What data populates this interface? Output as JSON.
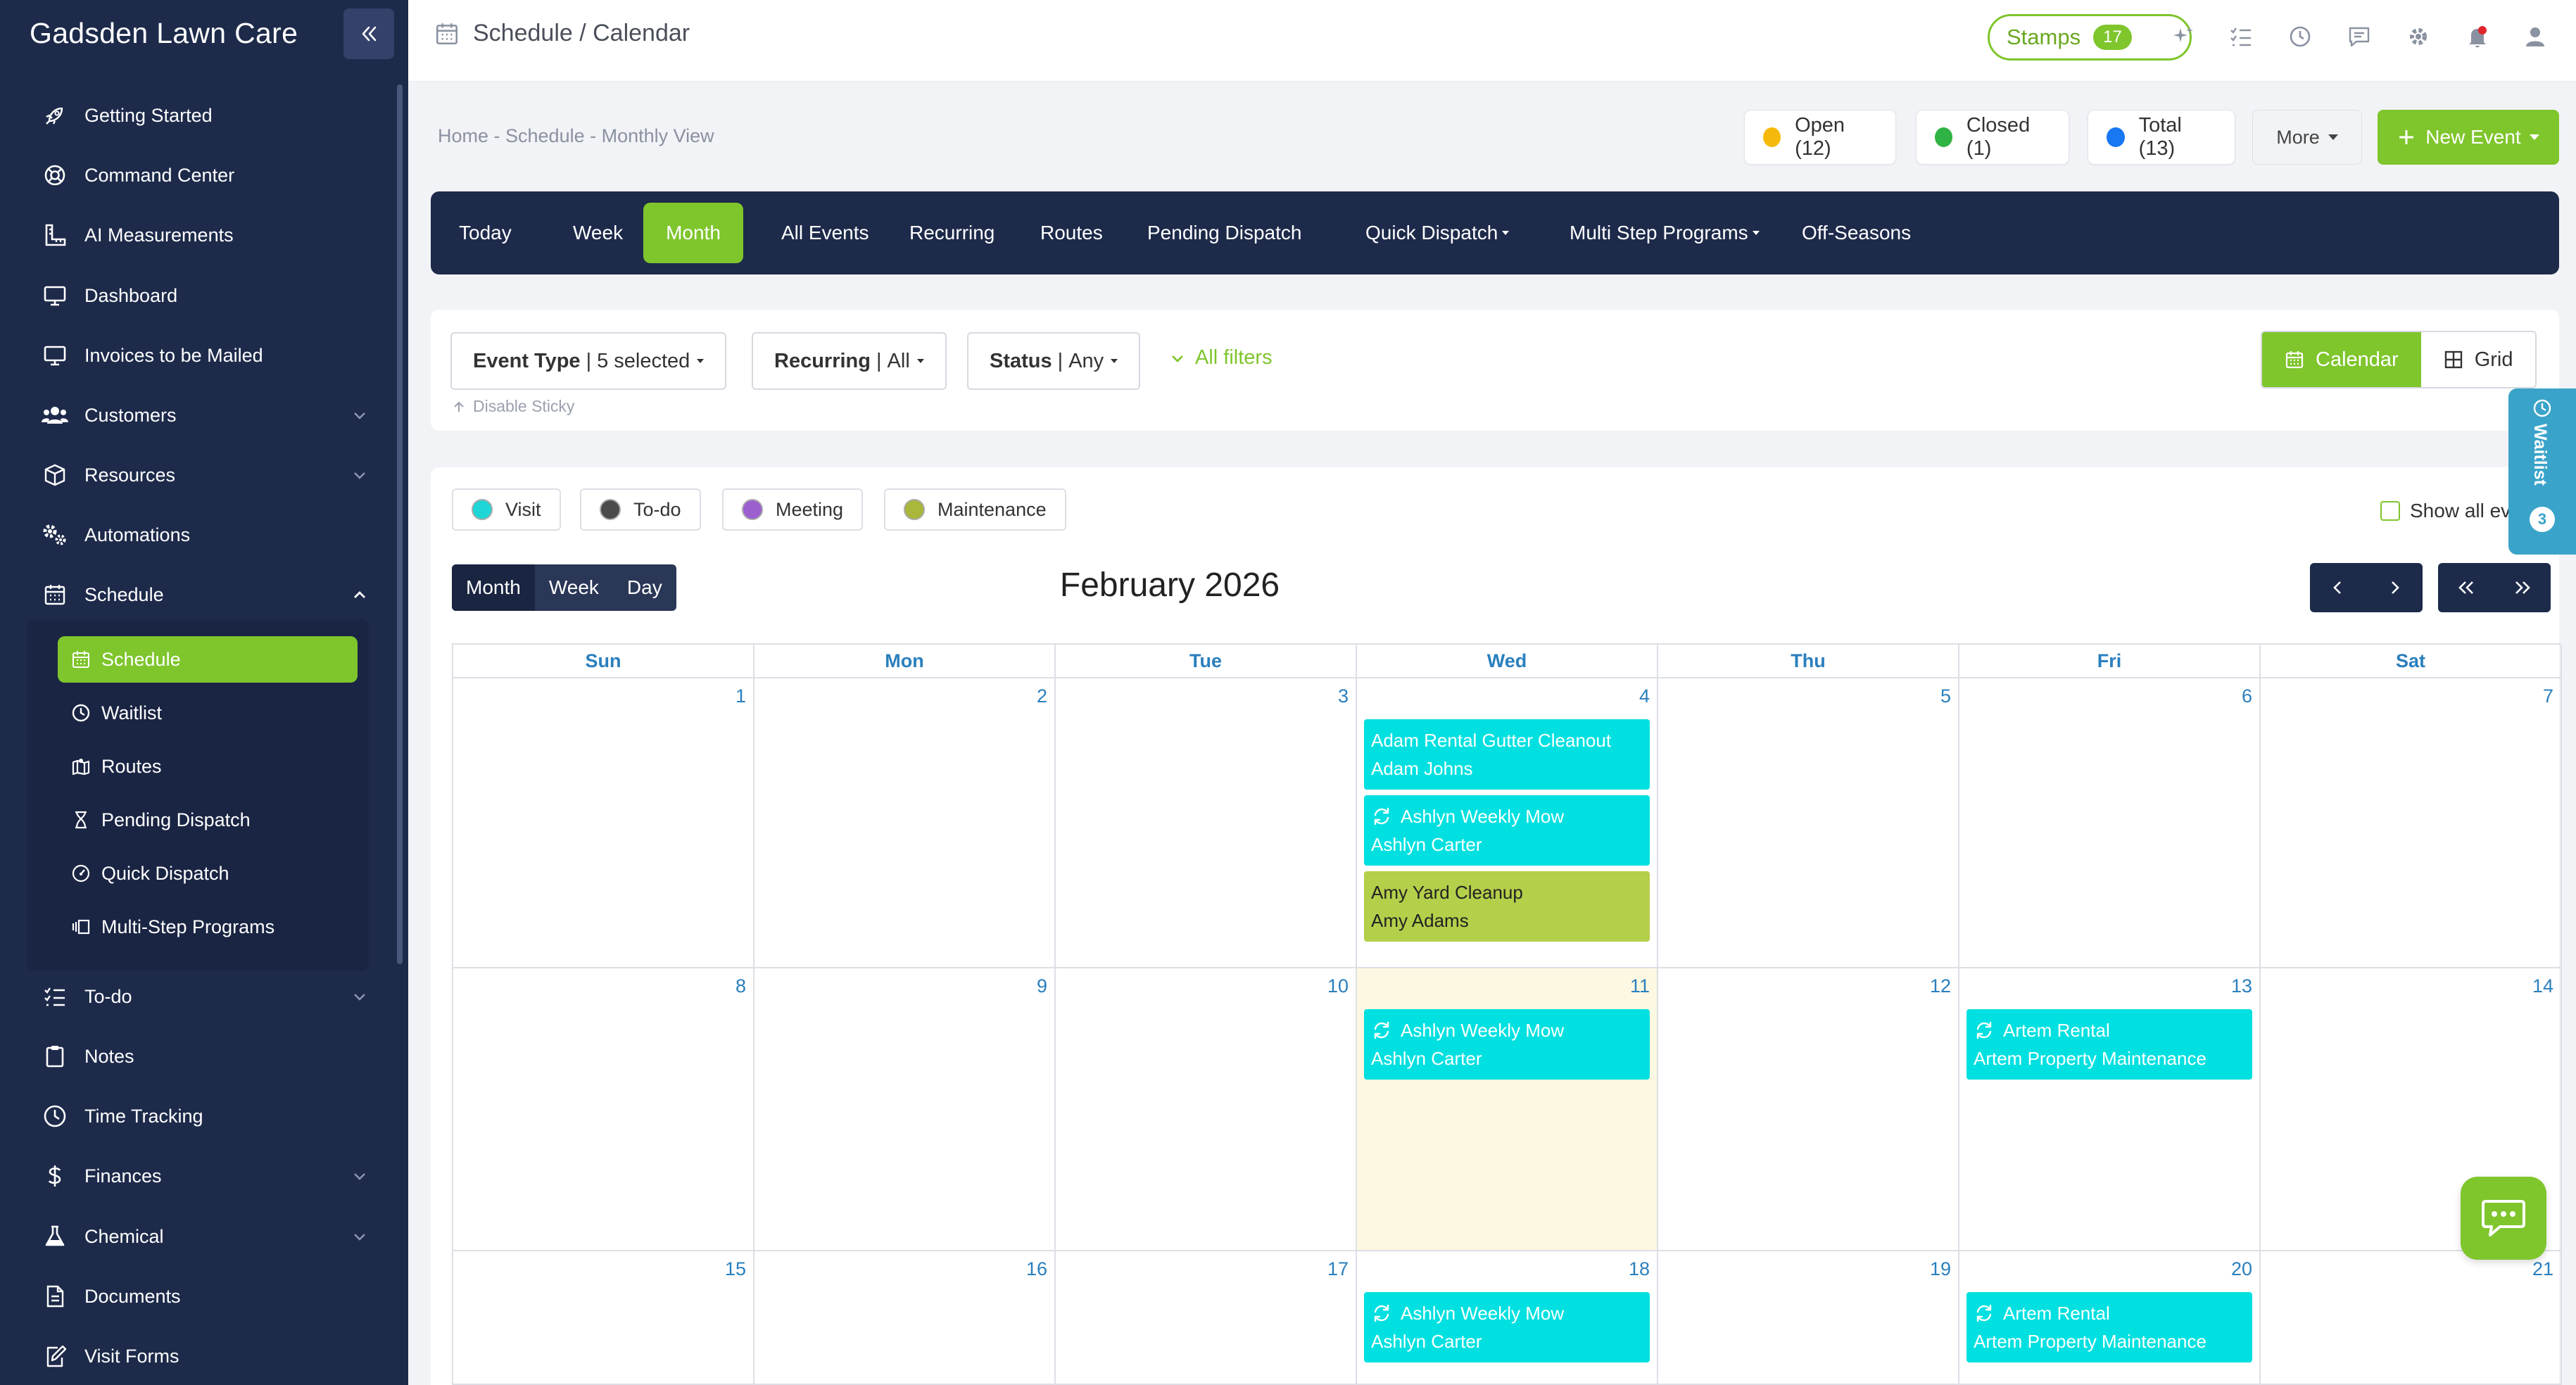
{
  "app": {
    "brand": "Gadsden Lawn Care"
  },
  "sidebar": {
    "items": [
      {
        "label": "Getting Started",
        "icon": "rocket-icon"
      },
      {
        "label": "Command Center",
        "icon": "life-ring-icon"
      },
      {
        "label": "AI Measurements",
        "icon": "ruler-icon"
      },
      {
        "label": "Dashboard",
        "icon": "monitor-icon"
      },
      {
        "label": "Invoices to be Mailed",
        "icon": "monitor-icon"
      },
      {
        "label": "Customers",
        "icon": "users-icon"
      },
      {
        "label": "Resources",
        "icon": "box-icon"
      },
      {
        "label": "Automations",
        "icon": "gears-icon"
      },
      {
        "label": "Schedule",
        "icon": "calendar-icon"
      }
    ],
    "schedule_sub": [
      {
        "label": "Schedule",
        "icon": "calendar-icon"
      },
      {
        "label": "Waitlist",
        "icon": "clock-icon"
      },
      {
        "label": "Routes",
        "icon": "map-icon"
      },
      {
        "label": "Pending Dispatch",
        "icon": "hourglass-icon"
      },
      {
        "label": "Quick Dispatch",
        "icon": "gauge-icon"
      },
      {
        "label": "Multi-Step Programs",
        "icon": "layers-icon"
      }
    ],
    "bottom_items": [
      {
        "label": "To-do",
        "icon": "list-check-icon"
      },
      {
        "label": "Notes",
        "icon": "clipboard-icon"
      },
      {
        "label": "Time Tracking",
        "icon": "clock-icon"
      },
      {
        "label": "Finances",
        "icon": "dollar-icon"
      },
      {
        "label": "Chemical",
        "icon": "flask-icon"
      },
      {
        "label": "Documents",
        "icon": "document-icon"
      },
      {
        "label": "Visit Forms",
        "icon": "edit-icon"
      }
    ]
  },
  "topbar": {
    "title": "Schedule / Calendar",
    "stamps_label": "Stamps",
    "stamps_count": "17"
  },
  "breadcrumb": "Home - Schedule - Monthly View",
  "status": {
    "open": "Open (12)",
    "closed": "Closed (1)",
    "total": "Total (13)",
    "colors": {
      "open": "#f5b90b",
      "closed": "#2fb344",
      "total": "#1877f2"
    }
  },
  "actions": {
    "more": "More",
    "new_event": "New Event"
  },
  "tabs": [
    "Today",
    "Week",
    "Month",
    "All Events",
    "Recurring",
    "Routes",
    "Pending Dispatch",
    "Quick Dispatch",
    "Multi Step Programs",
    "Off-Seasons"
  ],
  "filters": {
    "event_type_label": "Event Type",
    "event_type_value": "5 selected",
    "recurring_label": "Recurring",
    "recurring_value": "All",
    "status_label": "Status",
    "status_value": "Any",
    "all_filters": "All filters",
    "disable_sticky": "Disable Sticky",
    "view_calendar": "Calendar",
    "view_grid": "Grid"
  },
  "waitlist": {
    "label": "Waitlist",
    "count": "3"
  },
  "legend": [
    {
      "label": "Visit",
      "color": "#1fd6d6"
    },
    {
      "label": "To-do",
      "color": "#4a4a4a"
    },
    {
      "label": "Meeting",
      "color": "#9b5fd0"
    },
    {
      "label": "Maintenance",
      "color": "#a9b73a"
    }
  ],
  "calendar": {
    "show_all": "Show all ev",
    "view_modes": [
      "Month",
      "Week",
      "Day"
    ],
    "month_title": "February 2026",
    "weekdays": [
      "Sun",
      "Mon",
      "Tue",
      "Wed",
      "Thu",
      "Fri",
      "Sat"
    ],
    "weeks": [
      [
        "1",
        "2",
        "3",
        "4",
        "5",
        "6",
        "7"
      ],
      [
        "8",
        "9",
        "10",
        "11",
        "12",
        "13",
        "14"
      ],
      [
        "15",
        "16",
        "17",
        "18",
        "19",
        "20",
        "21"
      ]
    ],
    "events": {
      "4": [
        {
          "title": "Adam Rental Gutter Cleanout",
          "subtitle": "Adam Johns",
          "type": "visit",
          "recurring": false
        },
        {
          "title": "Ashlyn Weekly Mow",
          "subtitle": "Ashlyn Carter",
          "type": "visit",
          "recurring": true
        },
        {
          "title": "Amy Yard Cleanup",
          "subtitle": "Amy Adams",
          "type": "maint",
          "recurring": false
        }
      ],
      "11": [
        {
          "title": "Ashlyn Weekly Mow",
          "subtitle": "Ashlyn Carter",
          "type": "visit",
          "recurring": true
        }
      ],
      "13": [
        {
          "title": "Artem Rental",
          "subtitle": "Artem Property Maintenance",
          "type": "visit",
          "recurring": true
        }
      ],
      "18": [
        {
          "title": "Ashlyn Weekly Mow",
          "subtitle": "Ashlyn Carter",
          "type": "visit",
          "recurring": true
        }
      ],
      "20": [
        {
          "title": "Artem Rental",
          "subtitle": "Artem Property Maintenance",
          "type": "visit",
          "recurring": true
        }
      ]
    },
    "today": "11"
  }
}
